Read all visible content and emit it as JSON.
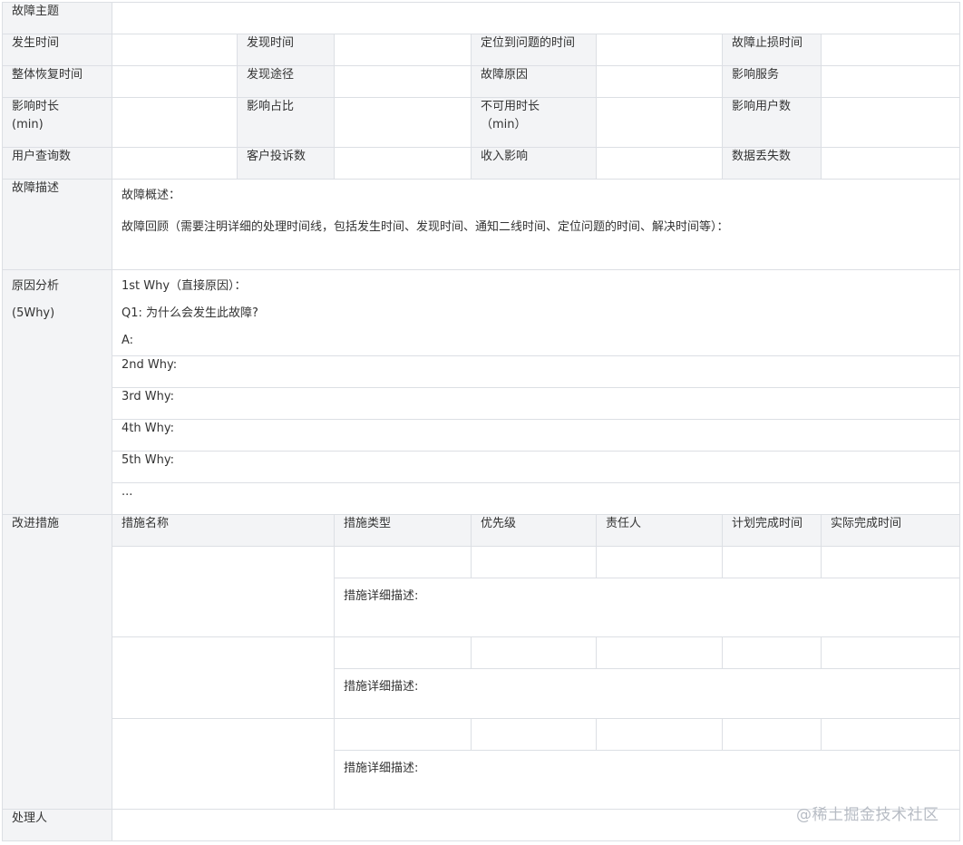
{
  "header": {
    "title_label": "故障主题",
    "row1": [
      "发生时间",
      "发现时间",
      "定位到问题的时间",
      "故障止损时间"
    ],
    "row2": [
      "整体恢复时间",
      "发现途径",
      "故障原因",
      "影响服务"
    ],
    "row3": [
      "影响时长\n(min)",
      "影响占比",
      "不可用时长\n（min）",
      "影响用户数"
    ],
    "row4": [
      "用户查询数",
      "客户投诉数",
      "收入影响",
      "数据丢失数"
    ]
  },
  "description": {
    "label": "故障描述",
    "overview": "故障概述：",
    "review": "故障回顾（需要注明详细的处理时间线，包括发生时间、发现时间、通知二线时间、定位问题的时间、解决时间等）："
  },
  "analysis": {
    "label": "原因分析\n\n(5Why)",
    "why1": [
      "1st Why（直接原因）：",
      "Q1: 为什么会发生此故障?",
      "A:"
    ],
    "why2": "2nd Why:",
    "why3": "3rd Why:",
    "why4": "4th Why:",
    "why5": "5th Why:",
    "more": "..."
  },
  "improvement": {
    "label": "改进措施",
    "columns": [
      "措施名称",
      "措施类型",
      "优先级",
      "责任人",
      "计划完成时间",
      "实际完成时间"
    ],
    "detail_label": "措施详细描述:"
  },
  "handler": {
    "label": "处理人"
  },
  "watermark": "@稀土掘金技术社区"
}
